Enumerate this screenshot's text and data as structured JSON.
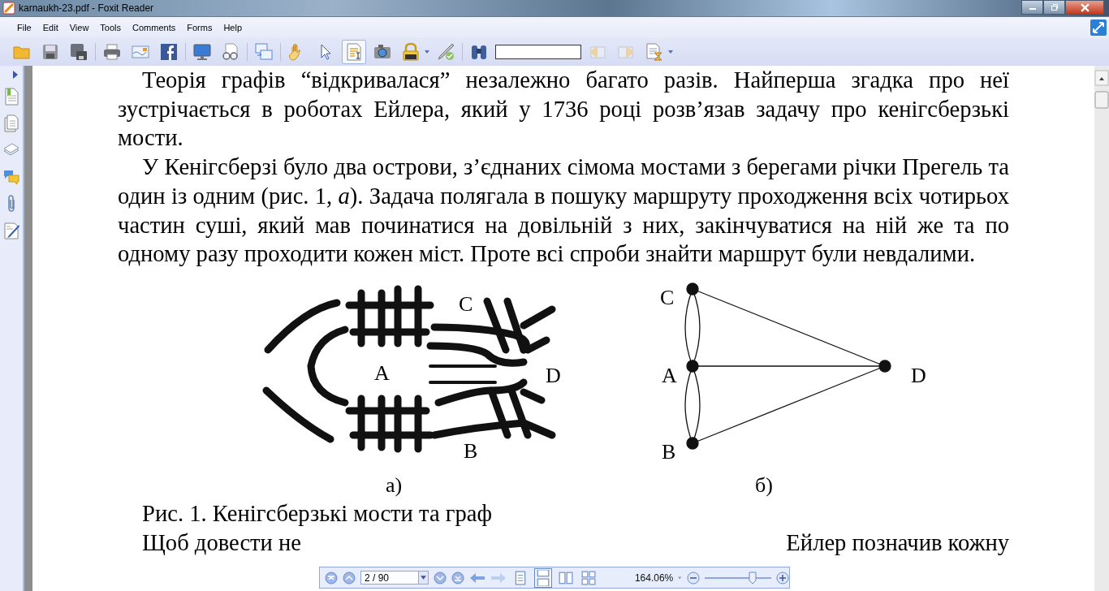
{
  "window": {
    "title": "karnaukh-23.pdf - Foxit Reader"
  },
  "menu": [
    "File",
    "Edit",
    "View",
    "Tools",
    "Comments",
    "Forms",
    "Help"
  ],
  "tools": {
    "hand": {
      "selected": false
    },
    "select": {
      "selected": false
    },
    "text_select": {
      "selected": true
    }
  },
  "document": {
    "paragraphs": [
      "Теорія графів “відкривалася” незалежно багато разів. Найперша згадка про неї зустрічається в роботах Ейлера, який у 1736 році розв’язав задачу про кенігсберзькі мости.",
      "У Кенігсберзі було два острови, з’єднаних сімома мостами з берегами річки Прегель та один із одним (рис. 1, *а*). Задача полягала в пошуку маршруту проходження всіх чотирьох частин суші, який мав починатися на довільній з них, закінчуватися на ній же та по одному разу проходити кожен міст. Проте всі спроби знайти маршрут були невдалими."
    ],
    "figure": {
      "panel_a": {
        "labels": [
          "C",
          "A",
          "D",
          "B"
        ],
        "caption": "а)"
      },
      "panel_b": {
        "labels": [
          "C",
          "A",
          "B",
          "D"
        ],
        "caption": "б)"
      }
    },
    "figure_caption": "Рис. 1. Кенігсберзькі мости та граф",
    "last_line": {
      "start": "Щоб довести не",
      "end": "Ейлер позначив кожну"
    }
  },
  "nav_toolbar": {
    "page": "2 / 90",
    "zoom": "164.06%",
    "zoom_slider": {
      "level": 0.72
    },
    "forward": {
      "disabled": true
    },
    "layouts": [
      {
        "selected": false
      },
      {
        "selected": true
      },
      {
        "selected": false
      },
      {
        "selected": false
      }
    ]
  }
}
